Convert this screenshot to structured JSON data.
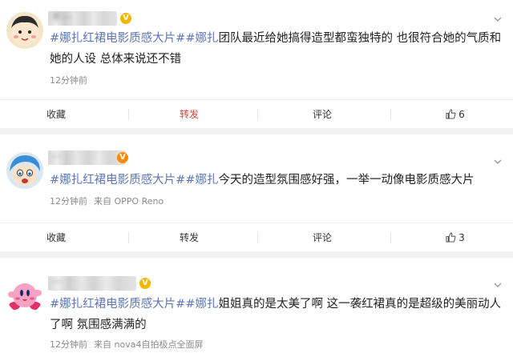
{
  "posts": [
    {
      "username": "不···",
      "tags": [
        "#娜扎",
        "红裙电影质感大片#",
        "娜扎"
      ],
      "text": "团队最近给她搞得造型都蛮独特的 也很符合她的气质和她的人设 总体来说还不错",
      "time": "12分钟前",
      "source": "",
      "actions": {
        "favorite": "收藏",
        "repost": "转发",
        "comment": "评论",
        "likes": "6"
      }
    },
    {
      "username": "···",
      "tags": [
        "#娜扎",
        "红裙电影质感大片#",
        "娜扎"
      ],
      "text": "今天的造型氛围感好强，一举一动像电影质感大片",
      "time": "12分钟前",
      "source": "来自 OPPO Reno",
      "actions": {
        "favorite": "收藏",
        "repost": "转发",
        "comment": "评论",
        "likes": "3"
      }
    },
    {
      "username": "···",
      "tags": [
        "#娜扎",
        "红裙电影质感大片#",
        "娜扎"
      ],
      "text": "姐姐真的是太美了啊 这一袭红裙真的是超级的美丽动人了啊 氛围感满满的",
      "time": "12分钟前",
      "source": "来自 nova4自拍极点全面屏",
      "actions": {}
    }
  ],
  "colors": {
    "tag": "#5d76b6",
    "repost": "#e0463a",
    "meta": "#8a8a8a",
    "divider": "#eeeeee",
    "badge": "#f7b500"
  },
  "icons": {
    "verified": "v-badge-icon",
    "more": "chevron-down-icon",
    "like": "thumbs-up-icon"
  }
}
